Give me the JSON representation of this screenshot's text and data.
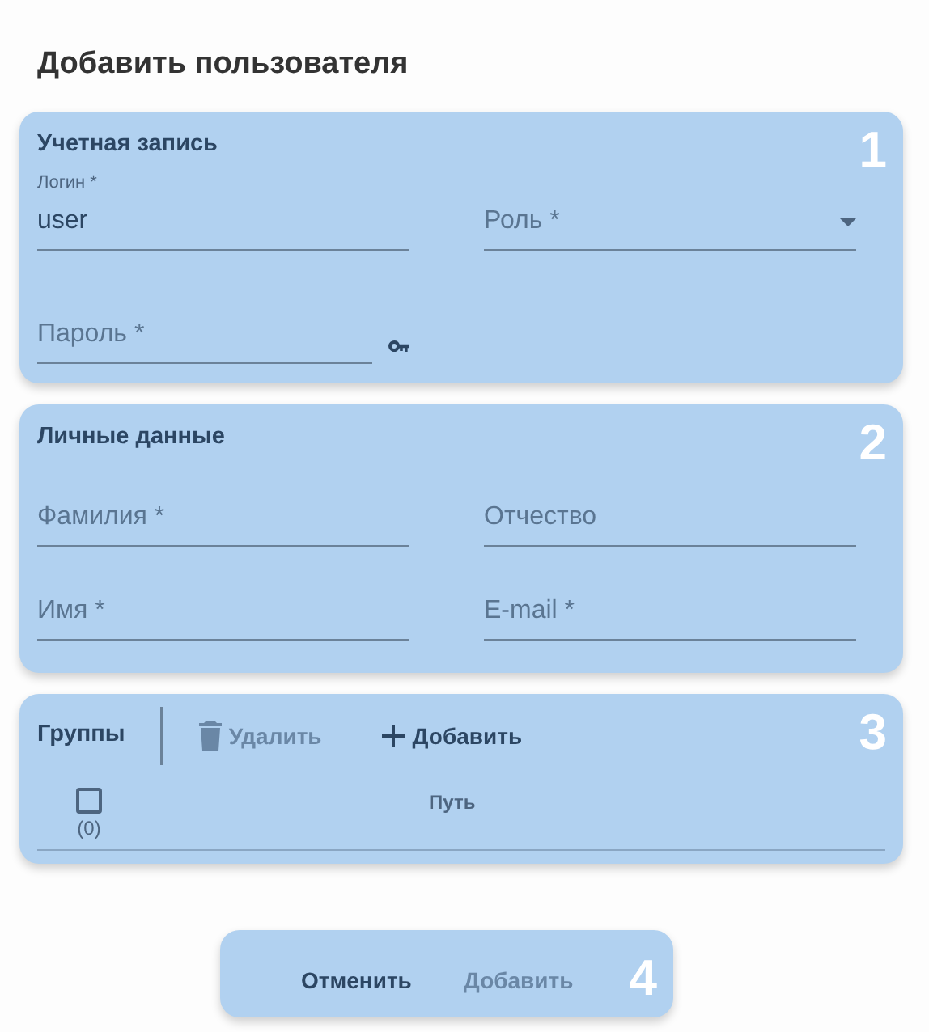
{
  "title": "Добавить пользователя",
  "account": {
    "title": "Учетная запись",
    "number": "1",
    "login": {
      "label": "Логин *",
      "value": "user"
    },
    "role": {
      "placeholder": "Роль *"
    },
    "password": {
      "placeholder": "Пароль *"
    }
  },
  "personal": {
    "title": "Личные данные",
    "number": "2",
    "fields": [
      {
        "placeholder": "Фамилия *"
      },
      {
        "placeholder": "Отчество"
      },
      {
        "placeholder": "Имя *"
      },
      {
        "placeholder": "E-mail *"
      }
    ]
  },
  "groups": {
    "title": "Группы",
    "number": "3",
    "actions": [
      {
        "kind": "delete",
        "label": "Удалить",
        "disabled": true
      },
      {
        "kind": "add",
        "label": "Добавить",
        "disabled": false
      }
    ],
    "select_all": {
      "checked": false,
      "count": "(0)"
    },
    "columns": [
      "Путь"
    ]
  },
  "footer": {
    "number": "4",
    "buttons": [
      {
        "label": "Отменить",
        "disabled": false
      },
      {
        "label": "Добавить",
        "disabled": true
      }
    ]
  }
}
